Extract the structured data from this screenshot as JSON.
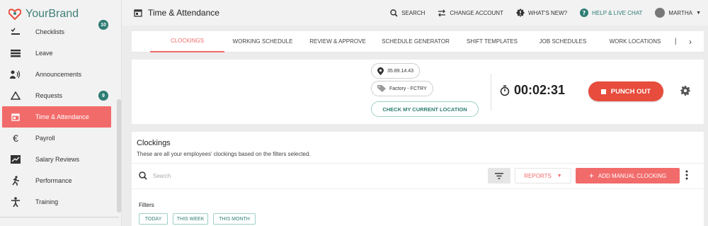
{
  "brand": {
    "name": "YourBrand",
    "color": "#3f7f7a"
  },
  "sidebar": {
    "items": [
      {
        "label": "Checklists",
        "icon": "checklist-icon",
        "badge": "10"
      },
      {
        "label": "Leave",
        "icon": "leave-icon"
      },
      {
        "label": "Announcements",
        "icon": "megaphone-icon"
      },
      {
        "label": "Requests",
        "icon": "triangle-icon",
        "badge": "9"
      },
      {
        "label": "Time & Attendance",
        "icon": "calendar-icon",
        "active": true
      },
      {
        "label": "Payroll",
        "icon": "euro-icon"
      },
      {
        "label": "Salary Reviews",
        "icon": "salary-review-icon"
      },
      {
        "label": "Performance",
        "icon": "running-person-icon"
      },
      {
        "label": "Training",
        "icon": "person-icon"
      }
    ]
  },
  "header": {
    "title": "Time & Attendance",
    "actions": {
      "search": "SEARCH",
      "change_account": "CHANGE ACCOUNT",
      "whats_new": "WHAT'S NEW?",
      "help": "HELP & LIVE CHAT",
      "user": "MARTHA"
    }
  },
  "tabs": [
    {
      "label": "CLOCKINGS",
      "active": true
    },
    {
      "label": "WORKING SCHEDULE"
    },
    {
      "label": "REVIEW & APPROVE"
    },
    {
      "label": "SCHEDULE GENERATOR"
    },
    {
      "label": "SHIFT TEMPLATES"
    },
    {
      "label": "JOB SCHEDULES"
    },
    {
      "label": "WORK LOCATIONS"
    }
  ],
  "punch": {
    "ip": "35.89.14.43",
    "location_tag": "Factory - FCTRY",
    "check_location_label": "CHECK MY CURRENT LOCATION",
    "timer": "00:02:31",
    "punch_out_label": "PUNCH OUT"
  },
  "clockings": {
    "title": "Clockings",
    "subtitle": "These are all your employees' clockings based on the filters selected.",
    "search_placeholder": "Search",
    "reports_label": "REPORTS",
    "add_label": "ADD MANUAL CLOCKING",
    "filters_label": "Filters",
    "filter_chips": [
      "TODAY",
      "THIS WEEK",
      "THIS MONTH"
    ]
  },
  "colors": {
    "accent": "#f26b6b",
    "punch_red": "#e74c3c",
    "teal": "#2f7d74"
  }
}
